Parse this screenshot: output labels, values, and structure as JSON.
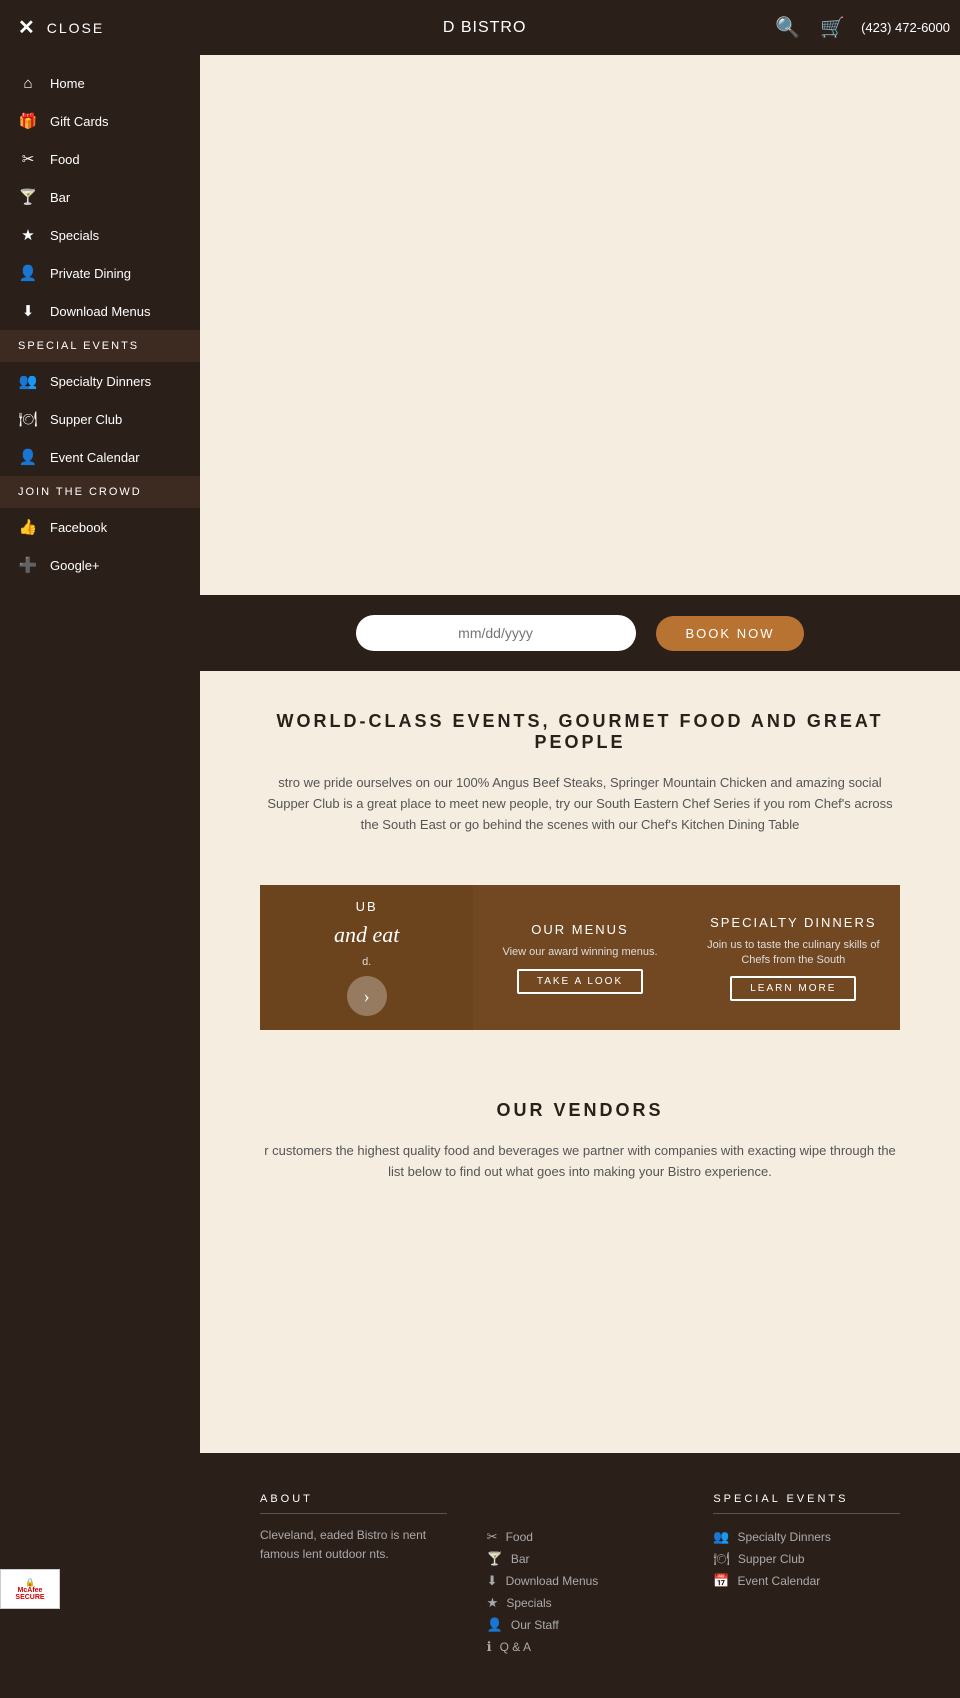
{
  "header": {
    "close_label": "CLOSE",
    "title": "D BISTRO",
    "phone": "(423) 472-6000"
  },
  "sidebar": {
    "nav_items": [
      {
        "id": "home",
        "label": "Home",
        "icon": "⌂"
      },
      {
        "id": "gift-cards",
        "label": "Gift Cards",
        "icon": "🎁"
      },
      {
        "id": "food",
        "label": "Food",
        "icon": "✂"
      },
      {
        "id": "bar",
        "label": "Bar",
        "icon": "🍸"
      },
      {
        "id": "specials",
        "label": "Specials",
        "icon": "★"
      },
      {
        "id": "private-dining",
        "label": "Private Dining",
        "icon": "👤"
      },
      {
        "id": "download-menus",
        "label": "Download Menus",
        "icon": "⬇"
      }
    ],
    "special_events_label": "SPECIAL EVENTS",
    "special_events_items": [
      {
        "id": "specialty-dinners",
        "label": "Specialty Dinners",
        "icon": "👥"
      },
      {
        "id": "supper-club",
        "label": "Supper Club",
        "icon": "🍽"
      },
      {
        "id": "event-calendar",
        "label": "Event Calendar",
        "icon": "👤"
      }
    ],
    "join_crowd_label": "JOIN THE CROWD",
    "social_items": [
      {
        "id": "facebook",
        "label": "Facebook",
        "icon": "👍"
      },
      {
        "id": "google-plus",
        "label": "Google+",
        "icon": "➕"
      }
    ]
  },
  "reservation": {
    "date_placeholder": "mm/dd/yyyy",
    "book_now_label": "BOOK NOW"
  },
  "world_class": {
    "title": "WORLD-CLASS EVENTS, GOURMET FOOD AND GREAT PEOPLE",
    "text": "stro we pride ourselves on our 100% Angus Beef Steaks, Springer Mountain Chicken and amazing social Supper Club is a great place to meet new people, try our South Eastern Chef Series if you rom Chef's across the South East or go behind the scenes with our Chef's Kitchen Dining Table"
  },
  "cards": [
    {
      "id": "supper-club-card",
      "title": "UB",
      "side_text": "and eat",
      "show_btn": false
    },
    {
      "id": "our-menus-card",
      "title": "OUR MENUS",
      "text": "View our award winning menus.",
      "btn_label": "TAKE A LOOK"
    },
    {
      "id": "specialty-dinners-card",
      "title": "SPECIALTY DINNERS",
      "text": "Join us to taste the culinary skills of Chefs from the South",
      "btn_label": "LEARN MORE"
    }
  ],
  "vendors": {
    "title": "OUR VENDORS",
    "text": "r customers the highest quality food and beverages we partner with companies with exacting wipe through the list below to find out what goes into making your Bistro experience."
  },
  "footer": {
    "about_label": "ABOUT",
    "about_text": "Cleveland, eaded Bistro is nent famous lent outdoor nts.",
    "about_links": [
      {
        "id": "food-link",
        "label": "Food",
        "icon": "✂"
      },
      {
        "id": "bar-link",
        "label": "Bar",
        "icon": "🍸"
      },
      {
        "id": "download-menus-link",
        "label": "Download Menus",
        "icon": "⬇"
      },
      {
        "id": "specials-link",
        "label": "Specials",
        "icon": "★"
      },
      {
        "id": "our-staff-link",
        "label": "Our Staff",
        "icon": "👤"
      },
      {
        "id": "qa-link",
        "label": "Q & A",
        "icon": "ℹ"
      }
    ],
    "special_events_label": "SPECIAL EVENTS",
    "special_events_links": [
      {
        "id": "specialty-dinners-footer",
        "label": "Specialty Dinners",
        "icon": "👥"
      },
      {
        "id": "supper-club-footer",
        "label": "Supper Club",
        "icon": "🍽"
      },
      {
        "id": "event-calendar-footer",
        "label": "Event Calendar",
        "icon": "📅"
      }
    ]
  },
  "mcafee": {
    "label": "McAfee",
    "sublabel": "SECURE"
  }
}
